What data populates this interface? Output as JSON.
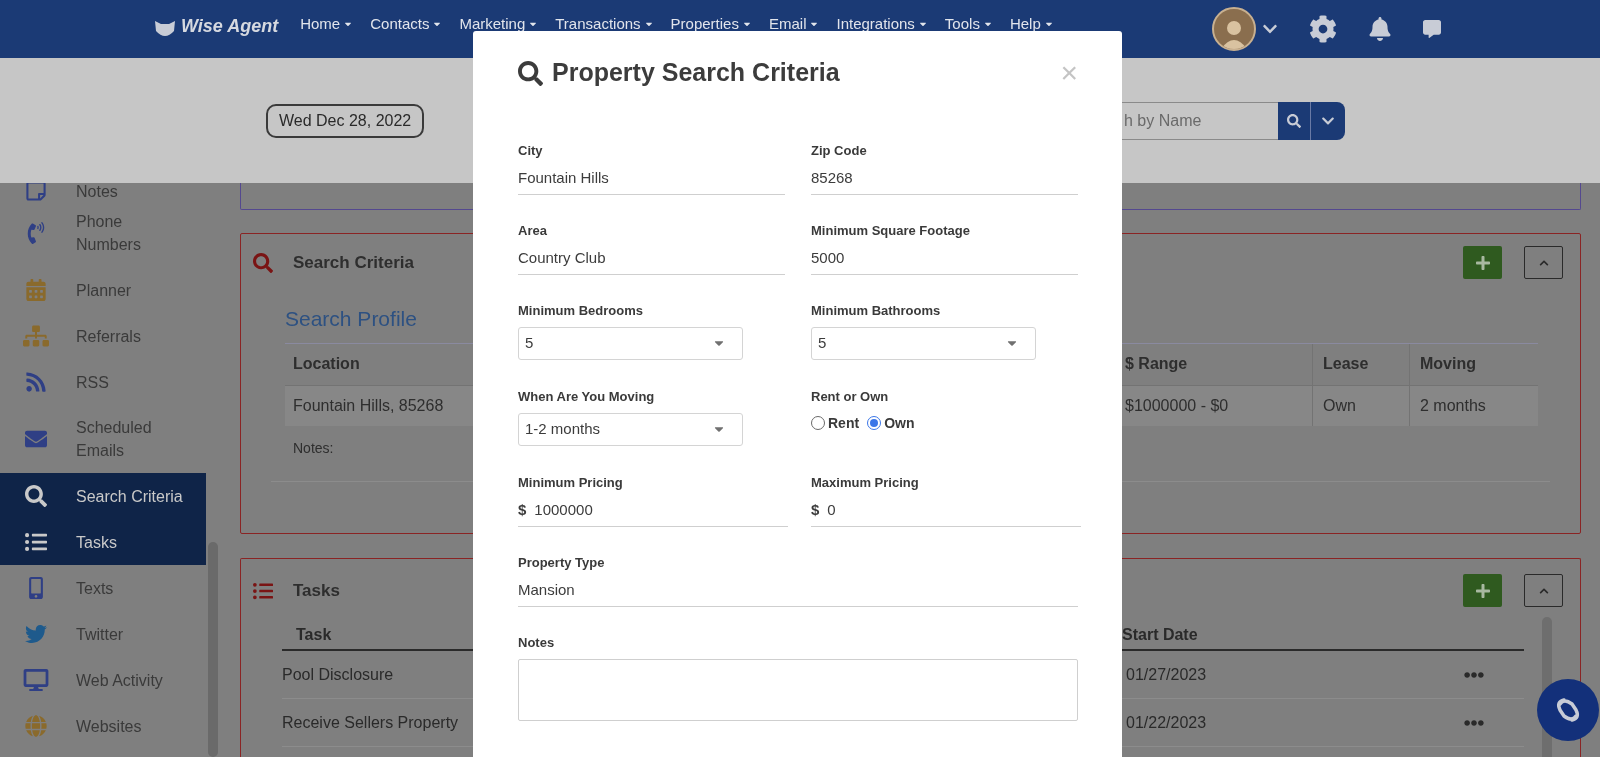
{
  "header": {
    "logo": "Wise Agent",
    "nav": [
      "Home",
      "Contacts",
      "Marketing",
      "Transactions",
      "Properties",
      "Email",
      "Integrations",
      "Tools",
      "Help"
    ]
  },
  "toolbar": {
    "date": "Wed Dec 28, 2022",
    "search": {
      "placeholder": "h by Name"
    }
  },
  "sidebar": {
    "items": [
      {
        "label": "Notes",
        "selected": false
      },
      {
        "label": "Phone Numbers",
        "selected": false
      },
      {
        "label": "Planner",
        "selected": false
      },
      {
        "label": "Referrals",
        "selected": false
      },
      {
        "label": "RSS",
        "selected": false
      },
      {
        "label": "Scheduled Emails",
        "selected": false
      },
      {
        "label": "Search Criteria",
        "selected": true
      },
      {
        "label": "Tasks",
        "selected": true
      },
      {
        "label": "Texts",
        "selected": false
      },
      {
        "label": "Twitter",
        "selected": false
      },
      {
        "label": "Web Activity",
        "selected": false
      },
      {
        "label": "Websites",
        "selected": false
      }
    ]
  },
  "search_criteria_card": {
    "title": "Search Criteria",
    "profile_title": "Search Profile",
    "columns": [
      "Location",
      "$ Range",
      "Lease",
      "Moving"
    ],
    "row": [
      "Fountain Hills, 85268",
      "$1000000 - $0",
      "Own",
      "2 months"
    ],
    "notes_label": "Notes:"
  },
  "tasks_card": {
    "title": "Tasks",
    "columns": [
      "Task",
      "Start Date"
    ],
    "rows": [
      {
        "task": "Pool Disclosure",
        "start_date": "01/27/2023"
      },
      {
        "task": "Receive Sellers Property",
        "start_date": "01/22/2023"
      }
    ]
  },
  "modal": {
    "title": "Property Search Criteria",
    "close": "×",
    "fields": [
      {
        "kind": "text",
        "label": "City",
        "value": "Fountain Hills"
      },
      {
        "kind": "text",
        "label": "Zip Code",
        "value": "85268"
      },
      {
        "kind": "text",
        "label": "Area",
        "value": "Country Club"
      },
      {
        "kind": "text",
        "label": "Minimum Square Footage",
        "value": "5000"
      },
      {
        "kind": "select",
        "label": "Minimum Bedrooms",
        "value": "5"
      },
      {
        "kind": "select",
        "label": "Minimum Bathrooms",
        "value": "5"
      },
      {
        "kind": "select",
        "label": "When Are You Moving",
        "value": "1-2 months"
      },
      {
        "kind": "radio",
        "label": "Rent or Own",
        "options": [
          {
            "label": "Rent",
            "selected": false
          },
          {
            "label": "Own",
            "selected": true
          }
        ]
      },
      {
        "kind": "money",
        "label": "Minimum Pricing",
        "prefix": "$",
        "value": "1000000"
      },
      {
        "kind": "money",
        "label": "Maximum Pricing",
        "prefix": "$",
        "value": "0"
      },
      {
        "kind": "wide_text",
        "label": "Property Type",
        "value": "Mansion"
      },
      {
        "kind": "textarea",
        "label": "Notes"
      }
    ]
  }
}
